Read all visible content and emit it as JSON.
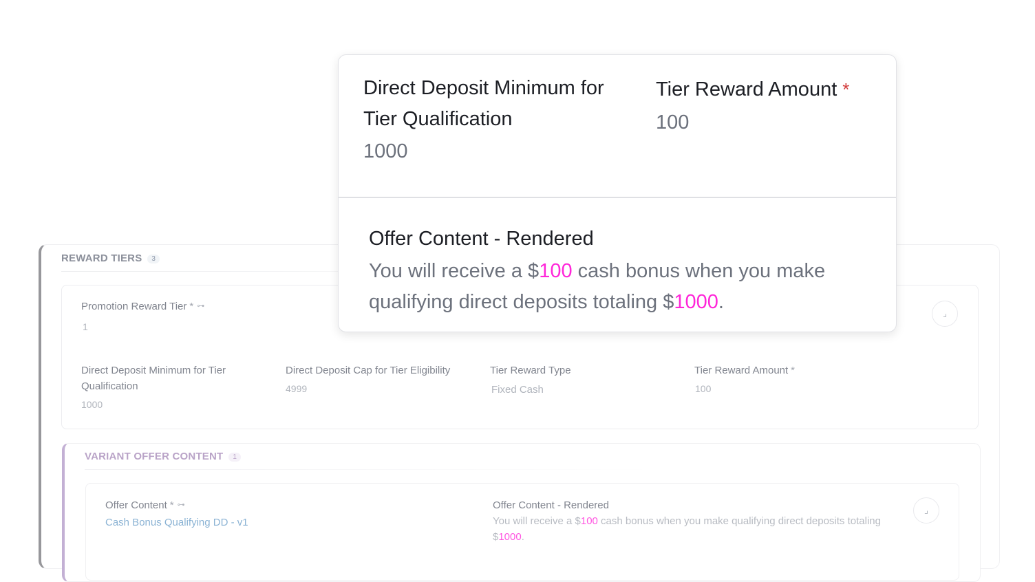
{
  "reward_tiers": {
    "title": "REWARD TIERS",
    "count": "3",
    "tier": {
      "promotion_reward_tier_label": "Promotion Reward Tier",
      "promotion_reward_tier_value": "1",
      "required_mark": "*",
      "dd_minimum_label": "Direct Deposit Minimum for Tier Qualification",
      "dd_minimum_value": "1000",
      "dd_cap_label": "Direct Deposit Cap for Tier Eligibility",
      "dd_cap_value": "4999",
      "reward_type_label": "Tier Reward Type",
      "reward_type_value": "Fixed Cash",
      "reward_amount_label": "Tier Reward Amount",
      "reward_amount_value": "100"
    }
  },
  "variant_offer_content": {
    "title": "VARIANT OFFER CONTENT",
    "count": "1",
    "offer_content_label": "Offer Content",
    "offer_content_value": "Cash Bonus Qualifying DD - v1",
    "rendered_label": "Offer Content - Rendered",
    "rendered_pre": "You will receive a $",
    "rendered_amount": "100",
    "rendered_mid": " cash bonus when you make qualifying direct deposits totaling $",
    "rendered_deposit": "1000",
    "rendered_post": "."
  },
  "zoom": {
    "dd_minimum_label": "Direct Deposit Minimum for Tier Qualification",
    "dd_minimum_value": "1000",
    "reward_amount_label": "Tier Reward Amount",
    "required_mark": "*",
    "reward_amount_value": "100",
    "rendered_label": "Offer Content - Rendered",
    "rendered_pre": "You will receive a $",
    "rendered_amount": "100",
    "rendered_mid": " cash bonus when you make qualifying direct deposits totaling $",
    "rendered_deposit": "1000",
    "rendered_post": "."
  },
  "colors": {
    "highlight": "#ff26d9",
    "link": "#6b9ec9",
    "variant_accent": "#b39ac8",
    "required": "#d23c3c"
  },
  "icons": {
    "key": "key-icon",
    "collapse": "collapse-icon"
  }
}
